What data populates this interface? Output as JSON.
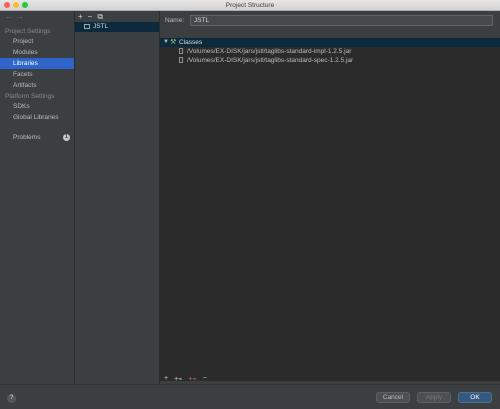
{
  "window": {
    "title": "Project Structure"
  },
  "sidebar": {
    "project_settings_label": "Project Settings",
    "project_items": [
      {
        "label": "Project"
      },
      {
        "label": "Modules"
      },
      {
        "label": "Libraries"
      },
      {
        "label": "Facets"
      },
      {
        "label": "Artifacts"
      }
    ],
    "platform_settings_label": "Platform Settings",
    "platform_items": [
      {
        "label": "SDKs"
      },
      {
        "label": "Global Libraries"
      }
    ],
    "problems": {
      "label": "Problems",
      "count": "1"
    },
    "selected": "Libraries"
  },
  "library_list": {
    "items": [
      {
        "label": "JSTL"
      }
    ]
  },
  "detail": {
    "name_label": "Name:",
    "name_value": "JSTL",
    "tree": {
      "root_label": "Classes",
      "files": [
        {
          "path": "/Volumes/EX-DISK/jars/jstl/taglibs-standard-impl-1.2.5.jar"
        },
        {
          "path": "/Volumes/EX-DISK/jars/jstl/taglibs-standard-spec-1.2.5.jar"
        }
      ]
    }
  },
  "footer": {
    "help": "?",
    "cancel_label": "Cancel",
    "apply_label": "Apply",
    "ok_label": "OK"
  },
  "colors": {
    "selection": "#2f65ca",
    "tree_selection": "#0d293e",
    "panel_bg": "#3c3f41",
    "editor_bg": "#2b2b2b",
    "ok_button": "#365880"
  }
}
